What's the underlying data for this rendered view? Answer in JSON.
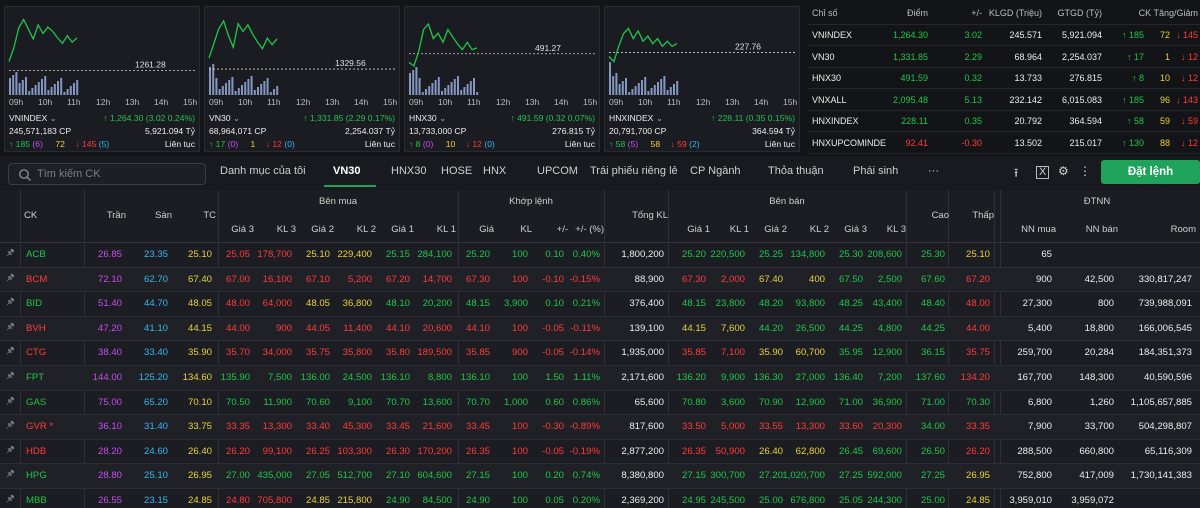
{
  "colors": {
    "up": "#1fc64a",
    "down": "#ff3b3b",
    "ref": "#e8d33a",
    "ceiling": "#c64df0",
    "floor": "#33b7f0",
    "accent": "#1fa35b"
  },
  "charts": [
    {
      "name": "VNINDEX",
      "value": "↑ 1,264.30 (3.02 0.24%)",
      "volume": "245,571,183 CP",
      "turnover": "5,921.094 Tỷ",
      "adv": "↑ 185",
      "adv_ceil": "(6)",
      "unch": "72",
      "dec": "↓ 145",
      "dec_floor": "(5)",
      "session": "Liên tục",
      "ref_label": "1261.28",
      "chart_data": {
        "type": "line",
        "x": [
          "09h",
          "10h",
          "11h",
          "12h",
          "13h",
          "14h",
          "15h"
        ],
        "ref": 1261.28,
        "series": [
          {
            "values": [
              1262.1,
              1263.4,
              1265.2,
              1266.0,
              1265.1,
              1264.2,
              1265.5,
              1264.7,
              1265.3,
              1264.9,
              1264.3,
              1263.8,
              1264.5,
              1263.9,
              1264.3
            ]
          }
        ]
      }
    },
    {
      "name": "VN30",
      "value": "↑ 1,331.85 (2.29 0.17%)",
      "volume": "68,964,071 CP",
      "turnover": "2,254.037 Tỷ",
      "adv": "↑ 17",
      "adv_ceil": "(0)",
      "unch": "1",
      "dec": "↓ 12",
      "dec_floor": "(0)",
      "session": "Liên tục",
      "ref_label": "1329.56",
      "chart_data": {
        "type": "line",
        "x": [
          "09h",
          "10h",
          "11h",
          "12h",
          "13h",
          "14h",
          "15h"
        ],
        "ref": 1329.56,
        "series": [
          {
            "values": [
              1330.4,
              1331.5,
              1332.6,
              1333.2,
              1332.1,
              1331.2,
              1333.0,
              1332.4,
              1332.9,
              1332.2,
              1331.6,
              1331.1,
              1331.9,
              1331.4,
              1331.85
            ]
          }
        ]
      }
    },
    {
      "name": "HNX30",
      "value": "↑ 491.59 (0.32 0.07%)",
      "volume": "13,733,000 CP",
      "turnover": "276.815 Tỷ",
      "adv": "↑ 8",
      "adv_ceil": "(0)",
      "unch": "10",
      "dec": "↓ 12",
      "dec_floor": "(0)",
      "session": "Liên tục",
      "ref_label": "491.27",
      "chart_data": {
        "type": "line",
        "x": [
          "09h",
          "10h",
          "11h",
          "12h",
          "13h",
          "14h",
          "15h"
        ],
        "ref": 491.27,
        "series": [
          {
            "values": [
              490.8,
              490.6,
              491.4,
              492.6,
              492.9,
              492.1,
              492.4,
              491.9,
              492.6,
              492.2,
              491.8,
              491.5,
              491.9,
              491.5,
              491.59
            ]
          }
        ]
      }
    },
    {
      "name": "HNXINDEX",
      "value": "↑ 228.11 (0.35 0.15%)",
      "volume": "20,791,700 CP",
      "turnover": "364.594 Tỷ",
      "adv": "↑ 58",
      "adv_ceil": "(5)",
      "unch": "58",
      "dec": "↓ 59",
      "dec_floor": "(2)",
      "session": "Liên tục",
      "ref_label": "227.76",
      "chart_data": {
        "type": "line",
        "x": [
          "09h",
          "10h",
          "11h",
          "12h",
          "13h",
          "14h",
          "15h"
        ],
        "ref": 227.76,
        "series": [
          {
            "values": [
              227.6,
              227.4,
              228.0,
              228.5,
              228.7,
              228.3,
              228.6,
              228.2,
              228.4,
              228.1,
              228.3,
              228.0,
              228.2,
              228.0,
              228.11
            ]
          }
        ]
      }
    }
  ],
  "index_table": {
    "headers": [
      "Chỉ số",
      "Điểm",
      "+/-",
      "KLGD (Triệu)",
      "GTGD (Tỷ)",
      "CK Tăng/Giảm"
    ],
    "rows": [
      {
        "name": "VNINDEX",
        "point": "1,264.30",
        "change": "3.02",
        "vol": "245.571",
        "val": "5,921.094",
        "adv": "↑ 185",
        "unch": "72",
        "dec": "↓ 145",
        "dir": "up"
      },
      {
        "name": "VN30",
        "point": "1,331.85",
        "change": "2.29",
        "vol": "68.964",
        "val": "2,254.037",
        "adv": "↑ 17",
        "unch": "1",
        "dec": "↓ 12",
        "dir": "up"
      },
      {
        "name": "HNX30",
        "point": "491.59",
        "change": "0.32",
        "vol": "13.733",
        "val": "276.815",
        "adv": "↑ 8",
        "unch": "10",
        "dec": "↓ 12",
        "dir": "up"
      },
      {
        "name": "VNXALL",
        "point": "2,095.48",
        "change": "5.13",
        "vol": "232.142",
        "val": "6,015.083",
        "adv": "↑ 185",
        "unch": "96",
        "dec": "↓ 143",
        "dir": "up"
      },
      {
        "name": "HNXINDEX",
        "point": "228.11",
        "change": "0.35",
        "vol": "20.792",
        "val": "364.594",
        "adv": "↑ 58",
        "unch": "59",
        "dec": "↓ 59",
        "dir": "up"
      },
      {
        "name": "HNXUPCOMINDE",
        "point": "92.41",
        "change": "-0.30",
        "vol": "13.502",
        "val": "215.017",
        "adv": "↑ 130",
        "unch": "88",
        "dec": "↓ 12",
        "dir": "dn"
      }
    ]
  },
  "toolbar": {
    "search_placeholder": "Tìm kiếm CK",
    "tabs": [
      "Danh mục của tôi",
      "VN30",
      "HNX30",
      "HOSE",
      "HNX",
      "UPCOM",
      "Trái phiếu riêng lẻ",
      "CP Ngành",
      "Thỏa thuận",
      "Phái sinh",
      "···"
    ],
    "order_label": "Đặt lệnh"
  },
  "grid": {
    "group_headers": {
      "buy": "Bên mua",
      "match": "Khớp lệnh",
      "sell": "Bên bán",
      "foreign": "ĐTNN"
    },
    "headers": [
      "CK",
      "Trần",
      "Sàn",
      "TC",
      "Giá 3",
      "KL 3",
      "Giá 2",
      "KL 2",
      "Giá 1",
      "KL 1",
      "Giá",
      "KL",
      "+/-",
      "+/- (%)",
      "Tổng KL",
      "Giá 1",
      "KL 1",
      "Giá 2",
      "KL 2",
      "Giá 3",
      "KL 3",
      "Cao",
      "Thấp",
      "NN mua",
      "NN bán",
      "Room"
    ],
    "rows": [
      {
        "c": [
          "ACB",
          "26.85",
          "23.35",
          "25.10",
          "25.05",
          "178,700",
          "25.10",
          "229,400",
          "25.15",
          "284,100",
          "25.20",
          "100",
          "0.10",
          "0.40%",
          "1,800,200",
          "25.20",
          "220,500",
          "25.25",
          "134,800",
          "25.30",
          "208,600",
          "25.30",
          "25.10",
          "65",
          "",
          ""
        ],
        "k": [
          "up",
          "ceil",
          "flr",
          "ref",
          "dn",
          "dn",
          "ref",
          "ref",
          "up",
          "up",
          "up",
          "up",
          "up",
          "up",
          "wht",
          "up",
          "up",
          "up",
          "up",
          "up",
          "up",
          "up",
          "ref",
          "wht",
          "wht",
          "wht"
        ]
      },
      {
        "c": [
          "BCM",
          "72.10",
          "62.70",
          "67.40",
          "67.00",
          "16,100",
          "67.10",
          "5,200",
          "67.20",
          "14,700",
          "67.30",
          "100",
          "-0.10",
          "-0.15%",
          "88,900",
          "67.30",
          "2,000",
          "67.40",
          "400",
          "67.50",
          "2,500",
          "67.60",
          "67.20",
          "900",
          "42,500",
          "330,817,247"
        ],
        "k": [
          "dn",
          "ceil",
          "flr",
          "ref",
          "dn",
          "dn",
          "dn",
          "dn",
          "dn",
          "dn",
          "dn",
          "dn",
          "dn",
          "dn",
          "wht",
          "dn",
          "dn",
          "ref",
          "ref",
          "up",
          "up",
          "up",
          "dn",
          "wht",
          "wht",
          "wht"
        ]
      },
      {
        "c": [
          "BID",
          "51.40",
          "44.70",
          "48.05",
          "48.00",
          "64,000",
          "48.05",
          "36,800",
          "48.10",
          "20,200",
          "48.15",
          "3,900",
          "0.10",
          "0.21%",
          "376,400",
          "48.15",
          "23,800",
          "48.20",
          "93,800",
          "48.25",
          "43,400",
          "48.40",
          "48.00",
          "27,300",
          "800",
          "739,988,091"
        ],
        "k": [
          "up",
          "ceil",
          "flr",
          "ref",
          "dn",
          "dn",
          "ref",
          "ref",
          "up",
          "up",
          "up",
          "up",
          "up",
          "up",
          "wht",
          "up",
          "up",
          "up",
          "up",
          "up",
          "up",
          "up",
          "dn",
          "wht",
          "wht",
          "wht"
        ]
      },
      {
        "c": [
          "BVH",
          "47.20",
          "41.10",
          "44.15",
          "44.00",
          "900",
          "44.05",
          "11,400",
          "44.10",
          "20,600",
          "44.10",
          "100",
          "-0.05",
          "-0.11%",
          "139,100",
          "44.15",
          "7,600",
          "44.20",
          "26,500",
          "44.25",
          "4,800",
          "44.25",
          "44.00",
          "5,400",
          "18,800",
          "166,006,545"
        ],
        "k": [
          "dn",
          "ceil",
          "flr",
          "ref",
          "dn",
          "dn",
          "dn",
          "dn",
          "dn",
          "dn",
          "dn",
          "dn",
          "dn",
          "dn",
          "wht",
          "ref",
          "ref",
          "up",
          "up",
          "up",
          "up",
          "up",
          "dn",
          "wht",
          "wht",
          "wht"
        ]
      },
      {
        "c": [
          "CTG",
          "38.40",
          "33.40",
          "35.90",
          "35.70",
          "34,000",
          "35.75",
          "35,800",
          "35.80",
          "189,500",
          "35.85",
          "900",
          "-0.05",
          "-0.14%",
          "1,935,000",
          "35.85",
          "7,100",
          "35.90",
          "60,700",
          "35.95",
          "12,900",
          "36.15",
          "35.75",
          "259,700",
          "20,284",
          "184,351,373"
        ],
        "k": [
          "dn",
          "ceil",
          "flr",
          "ref",
          "dn",
          "dn",
          "dn",
          "dn",
          "dn",
          "dn",
          "dn",
          "dn",
          "dn",
          "dn",
          "wht",
          "dn",
          "dn",
          "ref",
          "ref",
          "up",
          "up",
          "up",
          "dn",
          "wht",
          "wht",
          "wht"
        ]
      },
      {
        "c": [
          "FPT",
          "144.00",
          "125.20",
          "134.60",
          "135.90",
          "7,500",
          "136.00",
          "24,500",
          "136.10",
          "8,800",
          "136.10",
          "100",
          "1.50",
          "1.11%",
          "2,171,600",
          "136.20",
          "9,900",
          "136.30",
          "27,000",
          "136.40",
          "7,200",
          "137.60",
          "134.20",
          "167,700",
          "148,300",
          "40,590,596"
        ],
        "k": [
          "up",
          "ceil",
          "flr",
          "ref",
          "up",
          "up",
          "up",
          "up",
          "up",
          "up",
          "up",
          "up",
          "up",
          "up",
          "wht",
          "up",
          "up",
          "up",
          "up",
          "up",
          "up",
          "up",
          "dn",
          "wht",
          "wht",
          "wht"
        ]
      },
      {
        "c": [
          "GAS",
          "75.00",
          "65.20",
          "70.10",
          "70.50",
          "11,900",
          "70.60",
          "9,100",
          "70.70",
          "13,600",
          "70.70",
          "1,000",
          "0.60",
          "0.86%",
          "65,600",
          "70.80",
          "3,600",
          "70.90",
          "12,900",
          "71.00",
          "36,900",
          "71.00",
          "70.30",
          "6,800",
          "1,260",
          "1,105,657,885"
        ],
        "k": [
          "up",
          "ceil",
          "flr",
          "ref",
          "up",
          "up",
          "up",
          "up",
          "up",
          "up",
          "up",
          "up",
          "up",
          "up",
          "wht",
          "up",
          "up",
          "up",
          "up",
          "up",
          "up",
          "up",
          "up",
          "wht",
          "wht",
          "wht"
        ]
      },
      {
        "c": [
          "GVR *",
          "36.10",
          "31.40",
          "33.75",
          "33.35",
          "13,300",
          "33.40",
          "45,300",
          "33.45",
          "21,600",
          "33.45",
          "100",
          "-0.30",
          "-0.89%",
          "817,600",
          "33.50",
          "5,000",
          "33.55",
          "13,300",
          "33.60",
          "20,300",
          "34.00",
          "33.35",
          "7,900",
          "33,700",
          "504,298,807"
        ],
        "k": [
          "dn",
          "ceil",
          "flr",
          "ref",
          "dn",
          "dn",
          "dn",
          "dn",
          "dn",
          "dn",
          "dn",
          "dn",
          "dn",
          "dn",
          "wht",
          "dn",
          "dn",
          "dn",
          "dn",
          "dn",
          "dn",
          "up",
          "dn",
          "wht",
          "wht",
          "wht"
        ]
      },
      {
        "c": [
          "HDB",
          "28.20",
          "24.60",
          "26.40",
          "26.20",
          "99,100",
          "26.25",
          "103,300",
          "26.30",
          "170,200",
          "26.35",
          "100",
          "-0.05",
          "-0.19%",
          "2,877,200",
          "26.35",
          "50,900",
          "26.40",
          "62,800",
          "26.45",
          "69,600",
          "26.50",
          "26.20",
          "288,500",
          "660,800",
          "65,116,309"
        ],
        "k": [
          "dn",
          "ceil",
          "flr",
          "ref",
          "dn",
          "dn",
          "dn",
          "dn",
          "dn",
          "dn",
          "dn",
          "dn",
          "dn",
          "dn",
          "wht",
          "dn",
          "dn",
          "ref",
          "ref",
          "up",
          "up",
          "up",
          "dn",
          "wht",
          "wht",
          "wht"
        ]
      },
      {
        "c": [
          "HPG",
          "28.80",
          "25.10",
          "26.95",
          "27.00",
          "435,000",
          "27.05",
          "512,700",
          "27.10",
          "604,600",
          "27.15",
          "100",
          "0.20",
          "0.74%",
          "8,380,800",
          "27.15",
          "300,700",
          "27.20",
          "1,020,700",
          "27.25",
          "592,000",
          "27.25",
          "26.95",
          "752,800",
          "417,009",
          "1,730,141,383"
        ],
        "k": [
          "up",
          "ceil",
          "flr",
          "ref",
          "up",
          "up",
          "up",
          "up",
          "up",
          "up",
          "up",
          "up",
          "up",
          "up",
          "wht",
          "up",
          "up",
          "up",
          "up",
          "up",
          "up",
          "up",
          "ref",
          "wht",
          "wht",
          "wht"
        ]
      },
      {
        "c": [
          "MBB",
          "26.55",
          "23.15",
          "24.85",
          "24.80",
          "705,800",
          "24.85",
          "215,800",
          "24.90",
          "84,500",
          "24.90",
          "100",
          "0.05",
          "0.20%",
          "2,369,200",
          "24.95",
          "245,500",
          "25.00",
          "676,800",
          "25.05",
          "244,300",
          "25.00",
          "24.85",
          "3,959,010",
          "3,959,072",
          ""
        ],
        "k": [
          "up",
          "ceil",
          "flr",
          "ref",
          "dn",
          "dn",
          "ref",
          "ref",
          "up",
          "up",
          "up",
          "up",
          "up",
          "up",
          "wht",
          "up",
          "up",
          "up",
          "up",
          "up",
          "up",
          "up",
          "ref",
          "wht",
          "wht",
          "wht"
        ]
      }
    ]
  }
}
